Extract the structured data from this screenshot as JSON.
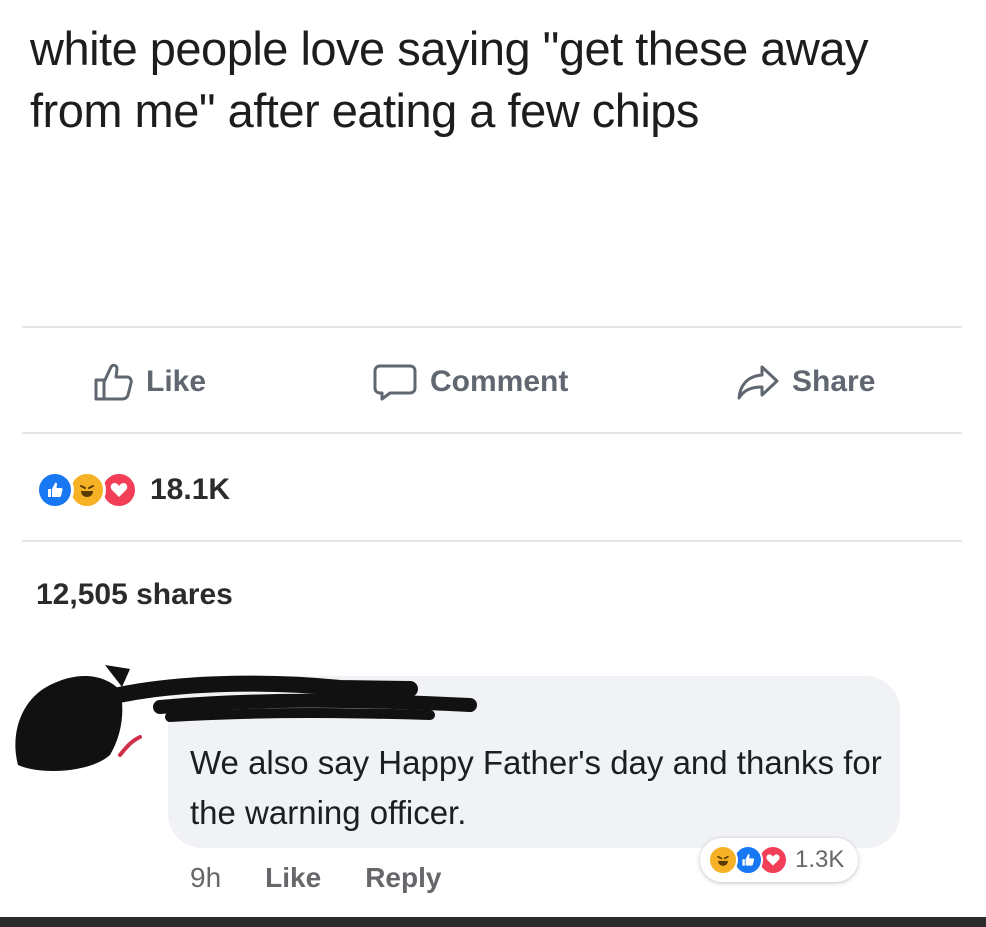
{
  "post": {
    "text": "white people love saying \"get these away from me\" after eating a few chips"
  },
  "actions": {
    "like_label": "Like",
    "comment_label": "Comment",
    "share_label": "Share"
  },
  "reactions": {
    "icons": [
      "like-icon",
      "haha-icon",
      "love-icon"
    ],
    "count": "18.1K"
  },
  "shares": {
    "text": "12,505 shares"
  },
  "comment": {
    "text": "We also say Happy Father's day and thanks for the warning officer.",
    "time": "9h",
    "like_label": "Like",
    "reply_label": "Reply",
    "reaction_icons": [
      "haha-icon",
      "like-icon",
      "love-icon"
    ],
    "reaction_count": "1.3K"
  },
  "colors": {
    "like_blue": "#1877f2",
    "haha_yellow": "#f7b125",
    "love_red": "#f33e58",
    "action_gray": "#606770",
    "bubble_gray": "#f0f2f5"
  }
}
